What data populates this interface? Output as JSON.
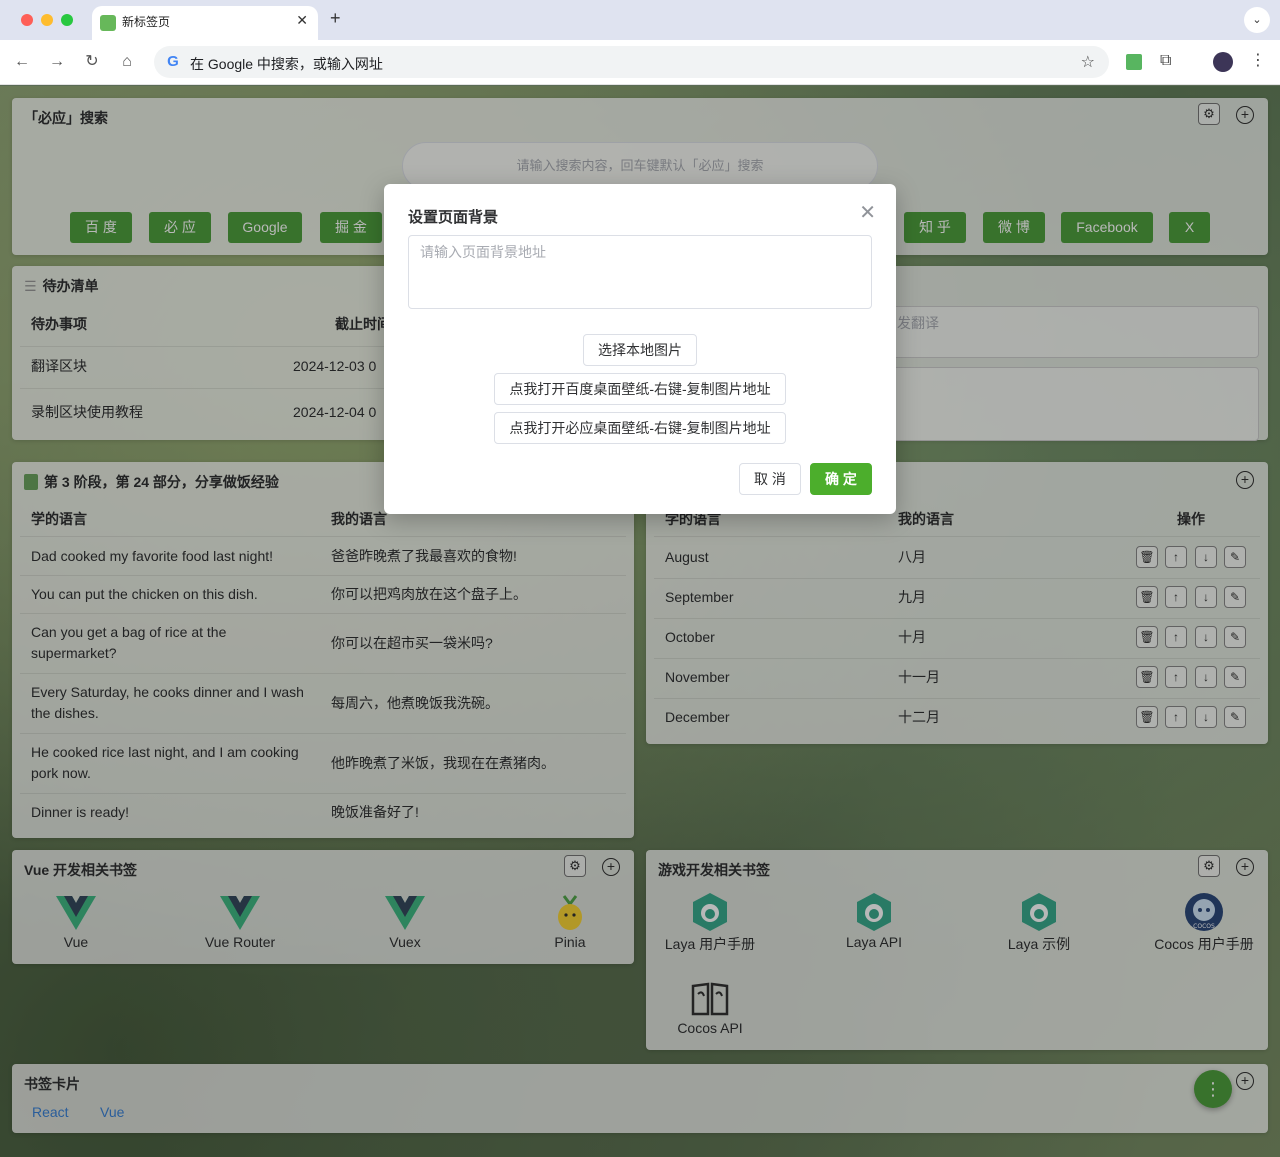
{
  "browser": {
    "tab_title": "新标签页",
    "tab_close": "✕",
    "new_tab": "+",
    "omnibox_text": "在 Google 中搜索，或输入网址",
    "g_logo": "G",
    "nav": {
      "back": "←",
      "forward": "→",
      "reload": "↻",
      "home": "⌂"
    },
    "star": "☆",
    "kebab": "⋮",
    "tab_menu": "⌄"
  },
  "search_card": {
    "title": "「必应」搜索",
    "placeholder": "请输入搜索内容，回车键默认「必应」搜索",
    "engines": [
      "百 度",
      "必 应",
      "Google",
      "掘 金",
      "知 乎",
      "微 博",
      "Facebook",
      "X"
    ]
  },
  "todo_card": {
    "title": "待办清单",
    "col_item": "待办事项",
    "col_deadline": "截止时间",
    "rows": [
      {
        "item": "翻译区块",
        "deadline": "2024-12-03 0"
      },
      {
        "item": "录制区块使用教程",
        "deadline": "2024-12-04 0"
      }
    ]
  },
  "translate_card": {
    "placeholder_tail": "发翻译"
  },
  "lesson_card": {
    "title": "第 3 阶段，第 24 部分，分享做饭经验",
    "col_learn": "学的语言",
    "col_mine": "我的语言",
    "rows": [
      {
        "learn": "Dad cooked my favorite food last night!",
        "mine": "爸爸昨晚煮了我最喜欢的食物!"
      },
      {
        "learn": "You can put the chicken on this dish.",
        "mine": "你可以把鸡肉放在这个盘子上。"
      },
      {
        "learn": "Can you get a bag of rice at the supermarket?",
        "mine": "你可以在超市买一袋米吗?"
      },
      {
        "learn": "Every Saturday, he cooks dinner and I wash the dishes.",
        "mine": "每周六，他煮晚饭我洗碗。"
      },
      {
        "learn": "He cooked rice last night, and I am cooking pork now.",
        "mine": "他昨晚煮了米饭，我现在在煮猪肉。"
      },
      {
        "learn": "Dinner is ready!",
        "mine": "晚饭准备好了!"
      }
    ]
  },
  "months_card": {
    "col_learn": "学的语言",
    "col_mine": "我的语言",
    "col_ops": "操作",
    "rows": [
      {
        "learn": "August",
        "mine": "八月"
      },
      {
        "learn": "September",
        "mine": "九月"
      },
      {
        "learn": "October",
        "mine": "十月"
      },
      {
        "learn": "November",
        "mine": "十一月"
      },
      {
        "learn": "December",
        "mine": "十二月"
      }
    ]
  },
  "vue_card": {
    "title": "Vue 开发相关书签",
    "items": [
      "Vue",
      "Vue Router",
      "Vuex",
      "Pinia"
    ]
  },
  "game_card": {
    "title": "游戏开发相关书签",
    "items": [
      "Laya 用户手册",
      "Laya API",
      "Laya 示例",
      "Cocos 用户手册",
      "Cocos API"
    ],
    "cocos_badge": "COCOS"
  },
  "bookmark_card": {
    "title": "书签卡片",
    "links": [
      "React",
      "Vue"
    ]
  },
  "dialog": {
    "title": "设置页面背景",
    "placeholder": "请输入页面背景地址",
    "btn_local": "选择本地图片",
    "btn_baidu": "点我打开百度桌面壁纸-右键-复制图片地址",
    "btn_bing": "点我打开必应桌面壁纸-右键-复制图片地址",
    "cancel": "取 消",
    "confirm": "确 定",
    "close": "✕"
  },
  "icons": {
    "gear": "⚙",
    "plus": "+",
    "delete": "🗑",
    "up": "↑",
    "down": "↓",
    "edit": "✎",
    "fab": "⋮"
  },
  "colors": {
    "accent": "#4e9f3d",
    "primary": "#4cae2c",
    "link": "#3b82d6",
    "vue_green": "#41b883",
    "vue_dark": "#35495e"
  }
}
